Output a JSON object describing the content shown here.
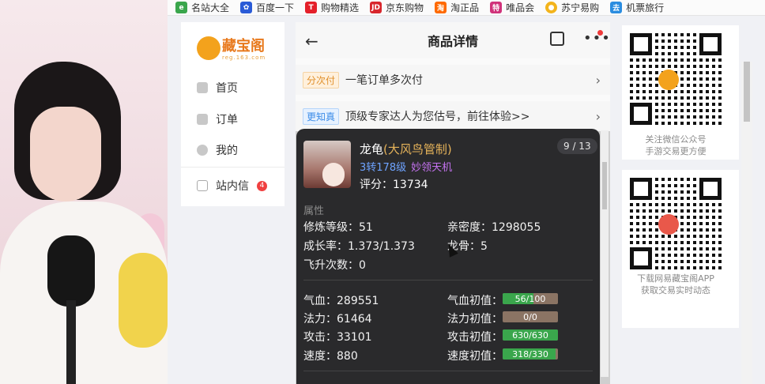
{
  "bookmarks": [
    {
      "label": "名站大全",
      "icon": "ie-icon",
      "color": "#3aa64c"
    },
    {
      "label": "百度一下",
      "icon": "baidu-paw-icon",
      "color": "#2a5bd7"
    },
    {
      "label": "购物精选",
      "icon": "tmall-t-icon",
      "color": "#e4202a"
    },
    {
      "label": "京东购物",
      "icon": "jd-icon",
      "color": "#d8262c"
    },
    {
      "label": "淘正品",
      "icon": "taobao-icon",
      "color": "#ff6a00"
    },
    {
      "label": "唯品会",
      "icon": "vip-icon",
      "color": "#d0327a"
    },
    {
      "label": "苏宁易购",
      "icon": "suning-icon",
      "color": "#f3b41b"
    },
    {
      "label": "机票旅行",
      "icon": "travel-icon",
      "color": "#2b8de0"
    }
  ],
  "nav": {
    "logo_text": "藏宝阁",
    "logo_sub": "reg.163.com",
    "items": [
      {
        "label": "首页",
        "icon": "home-icon"
      },
      {
        "label": "订单",
        "icon": "order-icon"
      },
      {
        "label": "我的",
        "icon": "user-icon"
      }
    ],
    "message": {
      "label": "站内信",
      "badge": "4",
      "icon": "mail-icon"
    }
  },
  "header": {
    "title": "商品详情",
    "back_glyph": "←",
    "more_glyph": "•••"
  },
  "banners": [
    {
      "tag": "分次付",
      "text": "一笔订单多次付"
    },
    {
      "tag": "更知真",
      "text": "顶级专家达人为您估号，前往体验>>"
    }
  ],
  "tooltip": {
    "pager": "9 / 13",
    "name": "龙龟",
    "grade": "(大风鸟管制)",
    "level": "3转178级",
    "school": "妙领天机",
    "score_label": "评分：",
    "score_value": "13734",
    "section_attr": "属性",
    "attrs": [
      {
        "label": "修炼等级：",
        "value": "51"
      },
      {
        "label": "亲密度：",
        "value": "1298055"
      },
      {
        "label": "成长率：",
        "value": "1.373/1.373"
      },
      {
        "label": "龙骨：",
        "value": "5"
      },
      {
        "label": "飞升次数：",
        "value": "0"
      }
    ],
    "stats": [
      {
        "label": "气血：",
        "value": "289551",
        "init_label": "气血初值：",
        "init_text": "56/100",
        "init_fraction": 0.56
      },
      {
        "label": "法力：",
        "value": "61464",
        "init_label": "法力初值：",
        "init_text": "0/0",
        "init_fraction": 0
      },
      {
        "label": "攻击：",
        "value": "33101",
        "init_label": "攻击初值：",
        "init_text": "630/630",
        "init_fraction": 1
      },
      {
        "label": "速度：",
        "value": "880",
        "init_label": "速度初值：",
        "init_text": "318/330",
        "init_fraction": 0.96
      }
    ]
  },
  "qr": [
    {
      "caption_1": "关注微信公众号",
      "caption_2": "手游交易更方便",
      "center_color": "#f3a21c"
    },
    {
      "caption_1": "下载网易藏宝阁APP",
      "caption_2": "获取交易实时动态",
      "center_color": "#e9584a"
    }
  ]
}
